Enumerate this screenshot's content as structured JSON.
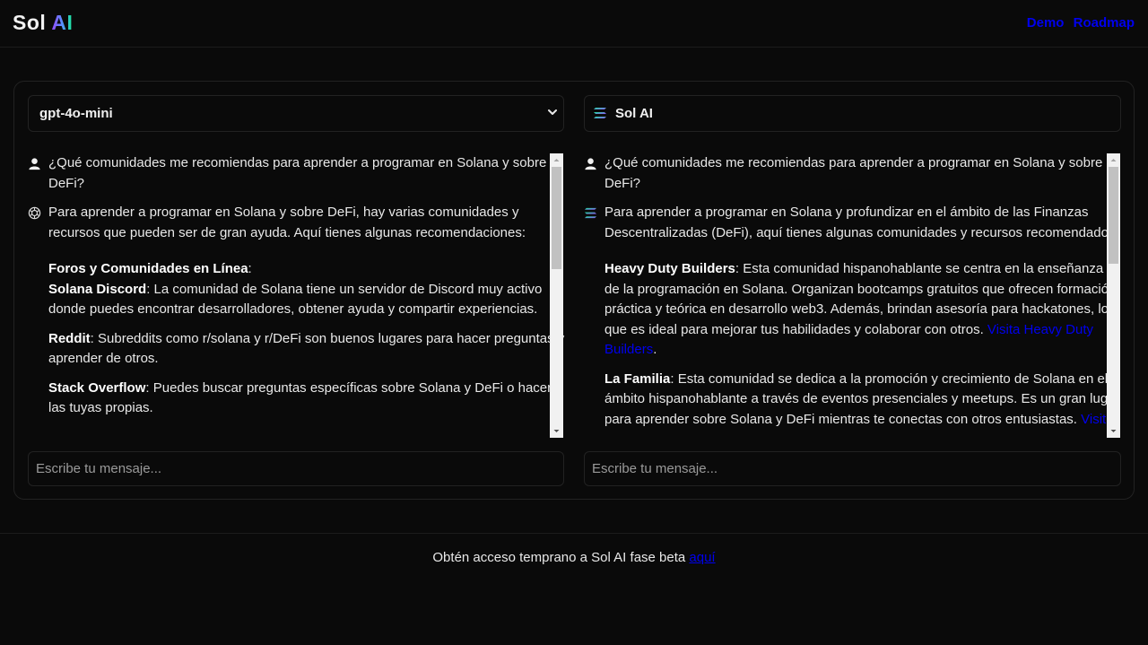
{
  "header": {
    "logo_main": "Sol",
    "logo_accent": "AI",
    "nav": [
      "Demo",
      "Roadmap"
    ]
  },
  "left_panel": {
    "model_select": "gpt-4o-mini",
    "user_question": "¿Qué comunidades me recomiendas para aprender a programar en Solana y sobre DeFi?",
    "answer_intro": "Para aprender a programar en Solana y sobre DeFi, hay varias comunidades y recursos que pueden ser de gran ayuda. Aquí tienes algunas recomendaciones:",
    "section_title": "Foros y Comunidades en Línea",
    "items": [
      {
        "title": "Solana Discord",
        "text": ": La comunidad de Solana tiene un servidor de Discord muy activo donde puedes encontrar desarrolladores, obtener ayuda y compartir experiencias."
      },
      {
        "title": "Reddit",
        "text": ": Subreddits como r/solana y r/DeFi son buenos lugares para hacer preguntas y aprender de otros."
      },
      {
        "title": "Stack Overflow",
        "text": ": Puedes buscar preguntas específicas sobre Solana y DeFi o hacer las tuyas propias."
      }
    ],
    "input_placeholder": "Escribe tu mensaje..."
  },
  "right_panel": {
    "title": "Sol AI",
    "user_question": "¿Qué comunidades me recomiendas para aprender a programar en Solana y sobre DeFi?",
    "answer_intro": "Para aprender a programar en Solana y profundizar en el ámbito de las Finanzas Descentralizadas (DeFi), aquí tienes algunas comunidades y recursos recomendados:",
    "items": [
      {
        "title": "Heavy Duty Builders",
        "text": ": Esta comunidad hispanohablante se centra en la enseñanza de la programación en Solana. Organizan bootcamps gratuitos que ofrecen formación práctica y teórica en desarrollo web3. Además, brindan asesoría para hackatones, lo que es ideal para mejorar tus habilidades y colaborar con otros. ",
        "link": "Visita Heavy Duty Builders",
        "tail": "."
      },
      {
        "title": "La Familia",
        "text": ": Esta comunidad se dedica a la promoción y crecimiento de Solana en el ámbito hispanohablante a través de eventos presenciales y meetups. Es un gran lugar para aprender sobre Solana y DeFi mientras te conectas con otros entusiastas. ",
        "link": "Visita",
        "tail": ""
      }
    ],
    "input_placeholder": "Escribe tu mensaje..."
  },
  "footer": {
    "text": "Obtén acceso temprano a Sol AI fase beta ",
    "link": "aquí"
  },
  "colors": {
    "background": "#0a0a0a",
    "link": "#0000ee",
    "border": "#222222"
  }
}
